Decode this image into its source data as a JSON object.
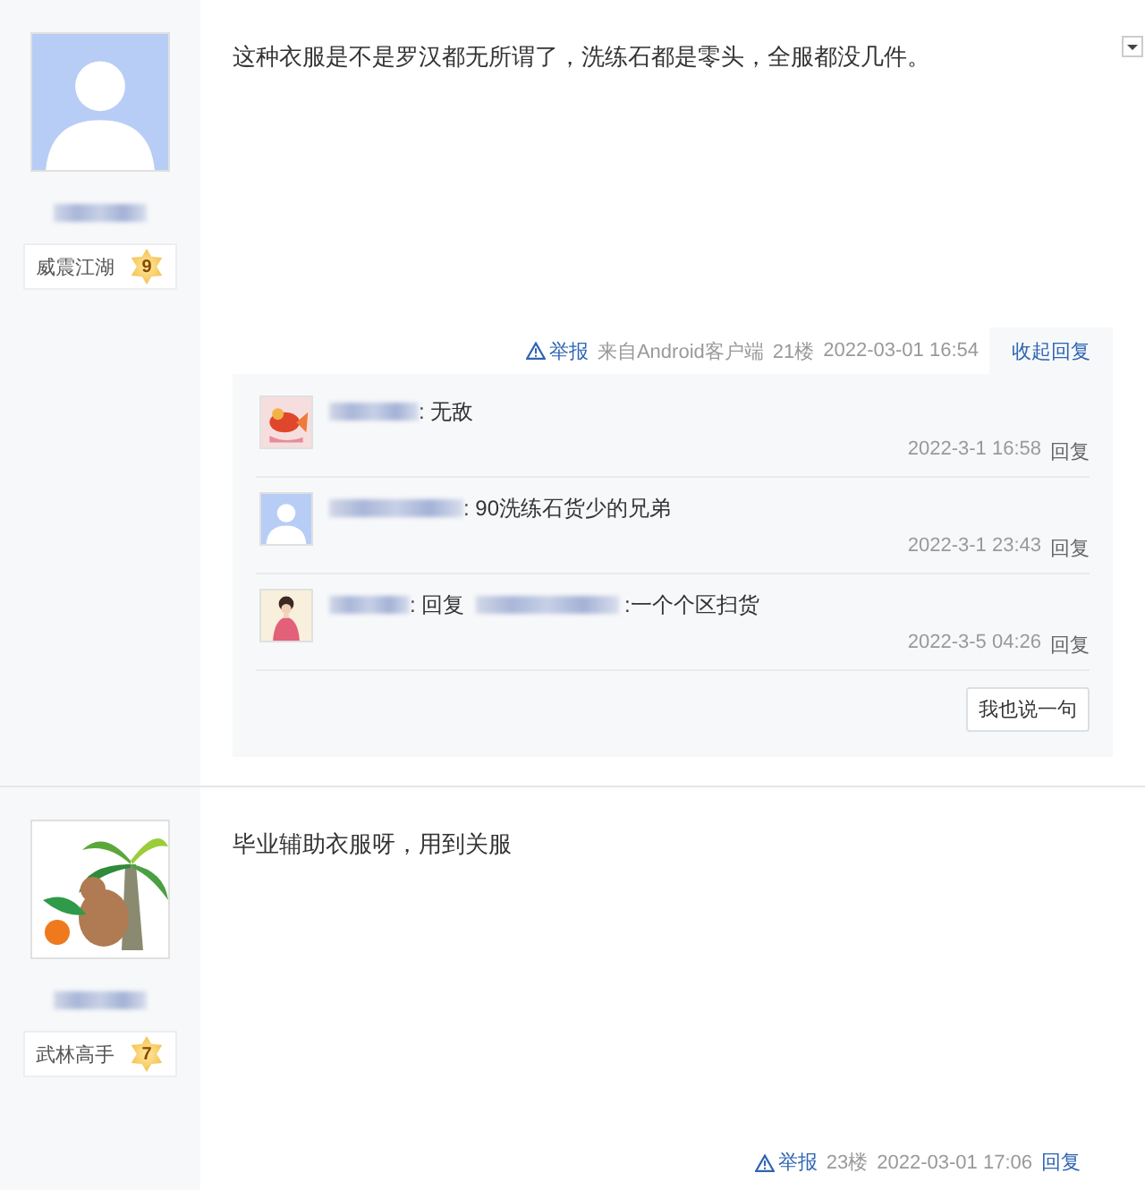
{
  "posts": [
    {
      "avatar": {
        "kind": "default"
      },
      "rank_title": "威震江湖",
      "rank_number": "9",
      "content": "这种衣服是不是罗汉都无所谓了，洗练石都是零头，全服都没几件。",
      "report": "举报",
      "source": "来自Android客户端",
      "floor": "21楼",
      "time": "2022-03-01 16:54",
      "reply_toggle": "收起回复",
      "replies": [
        {
          "avatar": {
            "kind": "fish"
          },
          "text": ": 无敌",
          "time": "2022-3-1 16:58",
          "action": "回复"
        },
        {
          "avatar": {
            "kind": "default"
          },
          "text": ": 90洗练石货少的兄弟",
          "time": "2022-3-1 23:43",
          "action": "回复"
        },
        {
          "avatar": {
            "kind": "figure"
          },
          "prefix": ": 回复",
          "text": " :一个个区扫货",
          "time": "2022-3-5 04:26",
          "action": "回复"
        }
      ],
      "reply_button": "我也说一句"
    },
    {
      "avatar": {
        "kind": "palm"
      },
      "rank_title": "武林高手",
      "rank_number": "7",
      "content": "毕业辅助衣服呀，用到关服",
      "report": "举报",
      "floor": "23楼",
      "time": "2022-03-01 17:06",
      "reply_link": "回复"
    }
  ]
}
